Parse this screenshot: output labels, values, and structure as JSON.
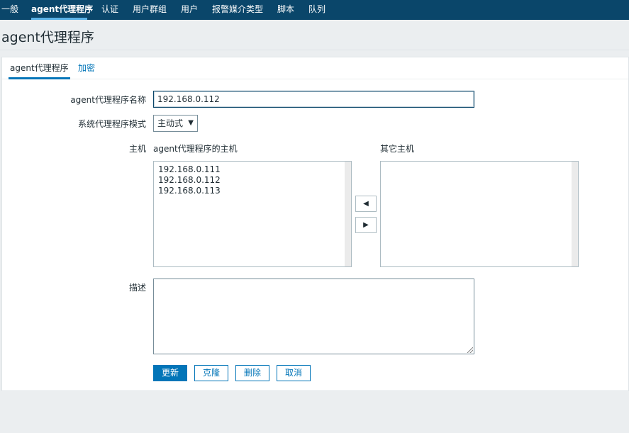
{
  "topnav": {
    "items": [
      "一般",
      "agent代理程序",
      "认证",
      "用户群组",
      "用户",
      "报警媒介类型",
      "脚本",
      "队列"
    ],
    "active_index": 1
  },
  "page_title": "agent代理程序",
  "tabs": [
    "agent代理程序",
    "加密"
  ],
  "form": {
    "name_label": "agent代理程序名称",
    "name_value": "192.168.0.112",
    "mode_label": "系统代理程序模式",
    "mode_value": "主动式",
    "hosts_label": "主机",
    "agent_hosts_caption": "agent代理程序的主机",
    "other_hosts_caption": "其它主机",
    "agent_hosts": [
      "192.168.0.111",
      "192.168.0.112",
      "192.168.0.113"
    ],
    "other_hosts": [],
    "description_label": "描述",
    "description_value": ""
  },
  "buttons": {
    "move_left": "◀",
    "move_right": "▶",
    "update": "更新",
    "clone": "克隆",
    "delete": "删除",
    "cancel": "取消"
  },
  "colors": {
    "nav_bg": "#0a466a",
    "primary": "#0275b8",
    "page_bg": "#ebeef0"
  }
}
